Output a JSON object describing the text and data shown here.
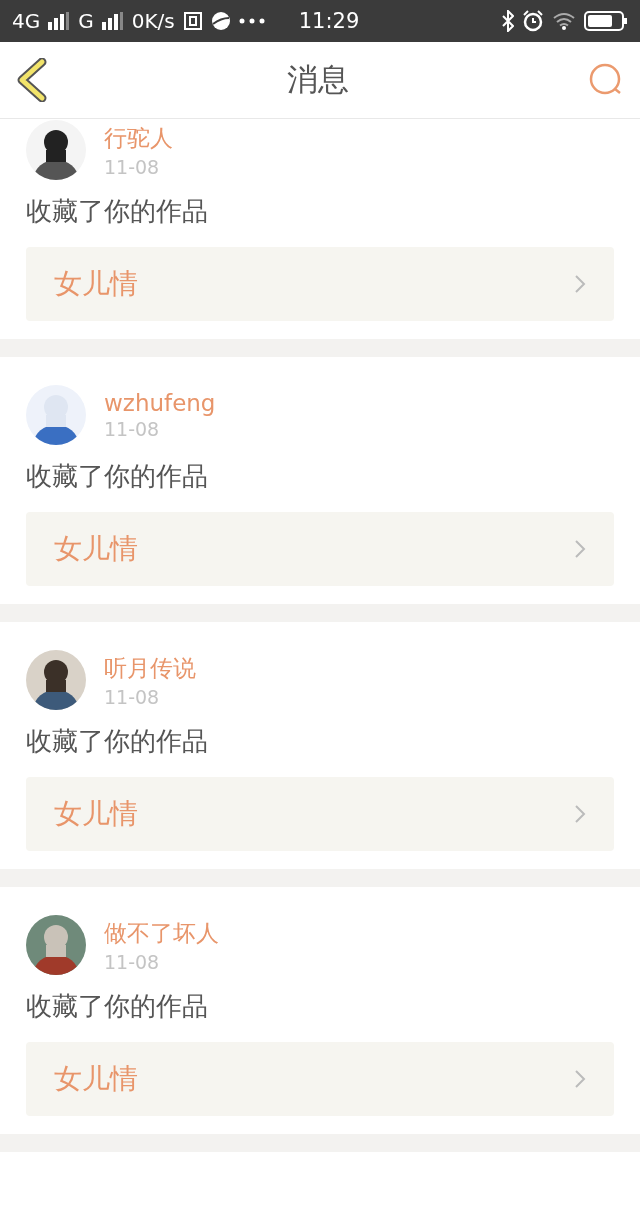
{
  "status_bar": {
    "network_1": "4G",
    "network_2": "G",
    "speed": "0K/s",
    "time": "11:29"
  },
  "header": {
    "title": "消息"
  },
  "messages": [
    {
      "user": "行驼人",
      "date": "11-08",
      "action": "收藏了你的作品",
      "work": "女儿情"
    },
    {
      "user": "wzhufeng",
      "date": "11-08",
      "action": "收藏了你的作品",
      "work": "女儿情"
    },
    {
      "user": "听月传说",
      "date": "11-08",
      "action": "收藏了你的作品",
      "work": "女儿情"
    },
    {
      "user": "做不了坏人",
      "date": "11-08",
      "action": "收藏了你的作品",
      "work": "女儿情"
    }
  ]
}
